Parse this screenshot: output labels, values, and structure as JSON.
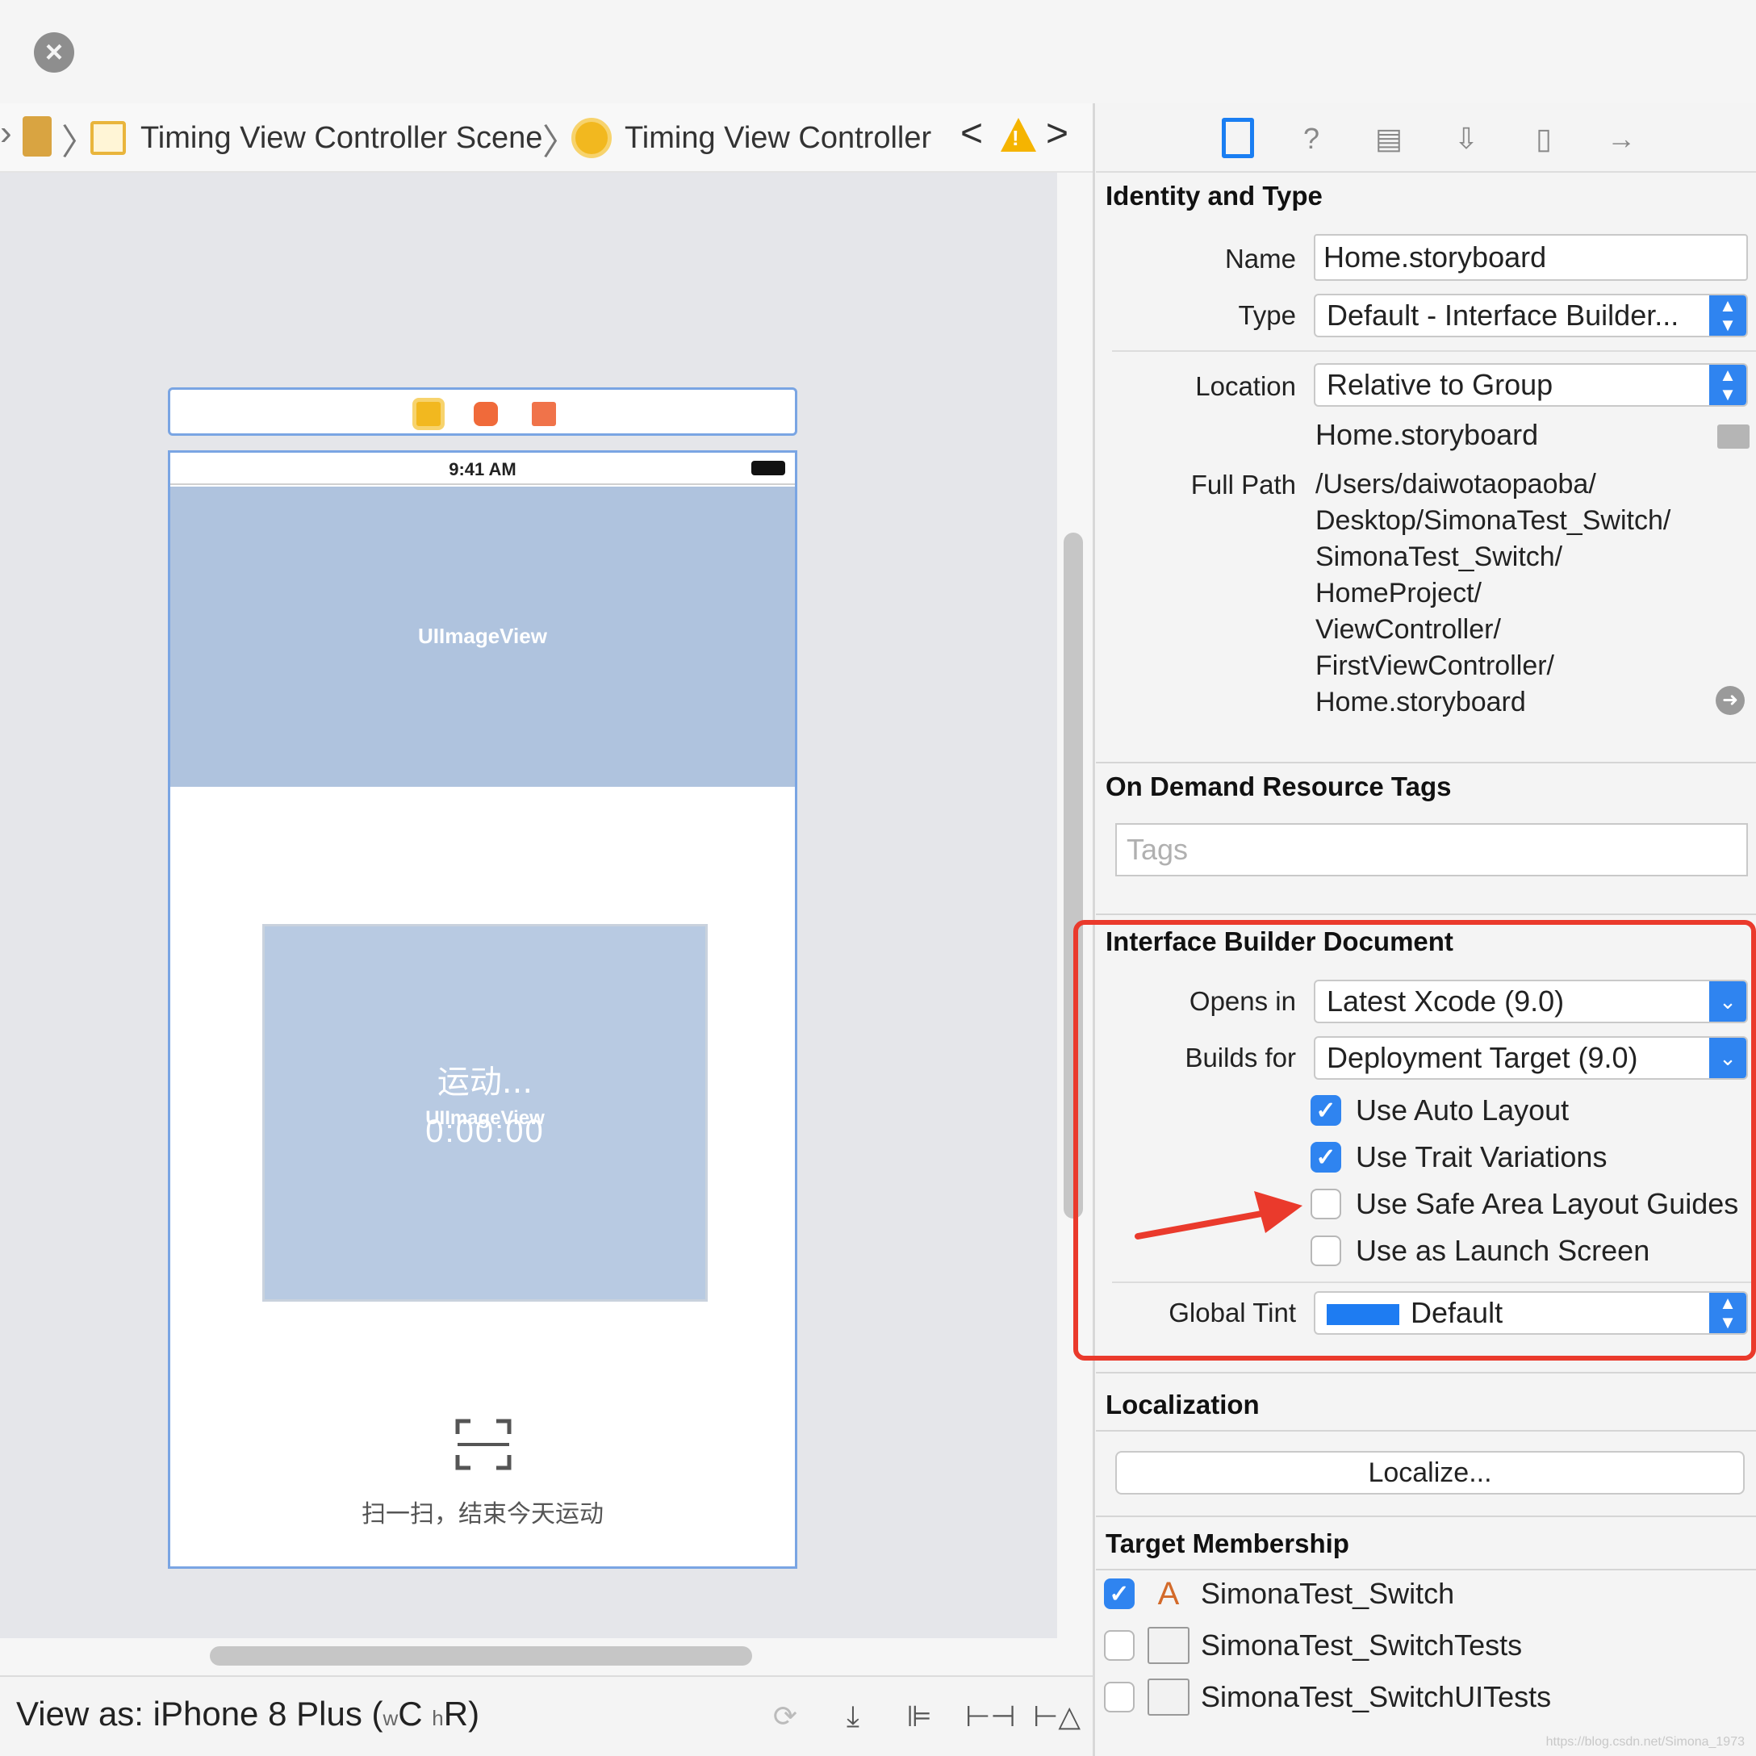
{
  "jumpbar": {
    "scene": "Timing View Controller Scene",
    "controller": "Timing View Controller"
  },
  "phone": {
    "status_time": "9:41 AM",
    "top_image_label": "UIImageView",
    "mid_text": "运动...",
    "mid_timer": "0:00:00",
    "mid_image_label": "UIImageView",
    "scan_text": "扫一扫，结束今天运动"
  },
  "bottombar": {
    "view_as_prefix": "View as: iPhone 8 Plus (",
    "w_small": "w",
    "w_class": "C",
    "h_small": "h",
    "h_class": "R",
    "suffix": ")"
  },
  "identity": {
    "title": "Identity and Type",
    "name_label": "Name",
    "name_value": "Home.storyboard",
    "type_label": "Type",
    "type_value": "Default - Interface Builder...",
    "location_label": "Location",
    "location_value": "Relative to Group",
    "file_name": "Home.storyboard",
    "full_path_label": "Full Path",
    "full_path_lines": [
      "/Users/daiwotaopaoba/",
      "Desktop/SimonaTest_Switch/",
      "SimonaTest_Switch/",
      "HomeProject/",
      "ViewController/",
      "FirstViewController/",
      "Home.storyboard"
    ]
  },
  "odr": {
    "title": "On Demand Resource Tags",
    "tags_placeholder": "Tags"
  },
  "ibdoc": {
    "title": "Interface Builder Document",
    "opens_in_label": "Opens in",
    "opens_in_value": "Latest Xcode (9.0)",
    "builds_for_label": "Builds for",
    "builds_for_value": "Deployment Target (9.0)",
    "checkboxes": [
      {
        "label": "Use Auto Layout",
        "checked": true
      },
      {
        "label": "Use Trait Variations",
        "checked": true
      },
      {
        "label": "Use Safe Area Layout Guides",
        "checked": false
      },
      {
        "label": "Use as Launch Screen",
        "checked": false
      }
    ],
    "global_tint_label": "Global Tint",
    "global_tint_value": "Default",
    "tint_color": "#1e7cf2"
  },
  "localization": {
    "title": "Localization",
    "button": "Localize..."
  },
  "membership": {
    "title": "Target Membership",
    "targets": [
      {
        "name": "SimonaTest_Switch",
        "checked": true
      },
      {
        "name": "SimonaTest_SwitchTests",
        "checked": false
      },
      {
        "name": "SimonaTest_SwitchUITests",
        "checked": false
      }
    ]
  },
  "watermark": "https://blog.csdn.net/Simona_1973",
  "colors": {
    "accent": "#2f84f0",
    "highlight": "#ea3a2c"
  }
}
